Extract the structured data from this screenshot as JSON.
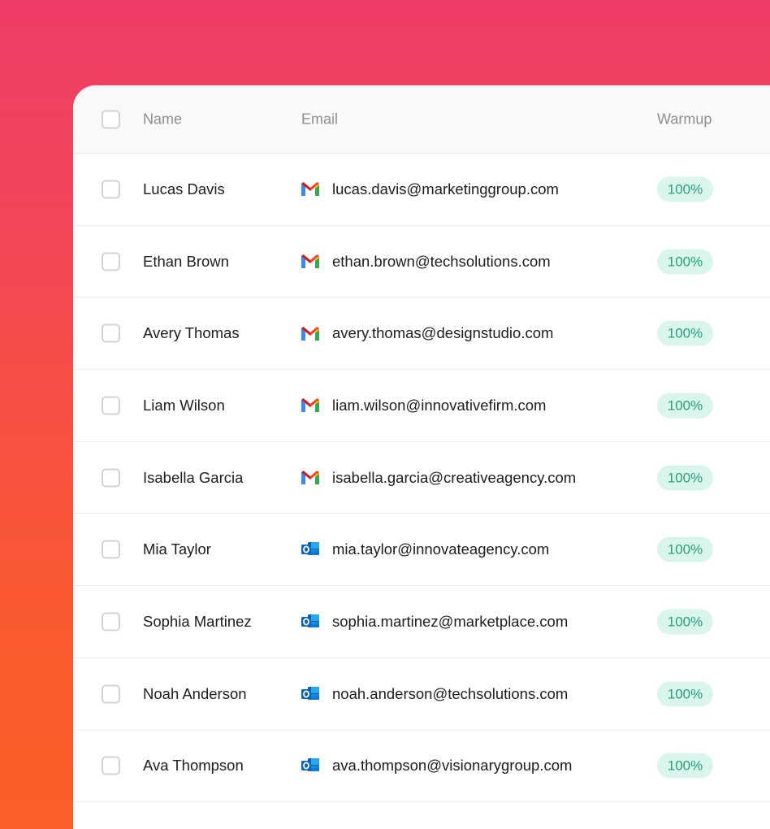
{
  "table": {
    "columns": {
      "name": "Name",
      "email": "Email",
      "warmup": "Warmup"
    },
    "rows": [
      {
        "name": "Lucas Davis",
        "email": "lucas.davis@marketinggroup.com",
        "provider": "gmail-icon",
        "warmup": "100%"
      },
      {
        "name": "Ethan Brown",
        "email": "ethan.brown@techsolutions.com",
        "provider": "gmail-icon",
        "warmup": "100%"
      },
      {
        "name": "Avery Thomas",
        "email": "avery.thomas@designstudio.com",
        "provider": "gmail-icon",
        "warmup": "100%"
      },
      {
        "name": "Liam Wilson",
        "email": "liam.wilson@innovativefirm.com",
        "provider": "gmail-icon",
        "warmup": "100%"
      },
      {
        "name": "Isabella Garcia",
        "email": "isabella.garcia@creativeagency.com",
        "provider": "gmail-icon",
        "warmup": "100%"
      },
      {
        "name": "Mia Taylor",
        "email": "mia.taylor@innovateagency.com",
        "provider": "outlook-icon",
        "warmup": "100%"
      },
      {
        "name": "Sophia Martinez",
        "email": "sophia.martinez@marketplace.com",
        "provider": "outlook-icon",
        "warmup": "100%"
      },
      {
        "name": "Noah Anderson",
        "email": "noah.anderson@techsolutions.com",
        "provider": "outlook-icon",
        "warmup": "100%"
      },
      {
        "name": "Ava Thompson",
        "email": "ava.thompson@visionarygroup.com",
        "provider": "outlook-icon",
        "warmup": "100%"
      }
    ]
  },
  "colors": {
    "background_top": "#F03C68",
    "background_bottom": "#FB5E27",
    "badge_bg": "#D9F5EC",
    "badge_text": "#24A07A",
    "header_text": "#8E8E8E"
  }
}
